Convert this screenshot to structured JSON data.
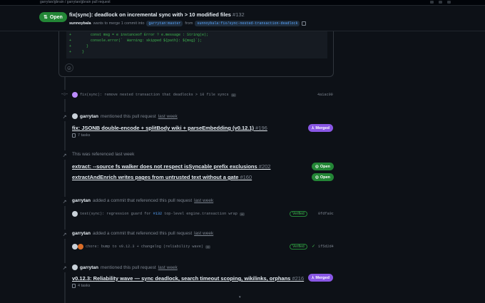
{
  "window": {
    "title": "garrytan/gbrain / garrytan/gbrain pull request"
  },
  "header": {
    "status": "Open",
    "title": "fix(sync): deadlock on incremental sync with > 10 modified files",
    "number": "#132",
    "author": "sunnoybala",
    "merge_text": "wants to merge 1 commit into",
    "base_branch": "garrytan:master",
    "from_text": "from",
    "head_branch": "sunnoybala:fix/sync-nested-transaction-deadlock"
  },
  "code": {
    "lines": [
      {
        "sign": "+",
        "text": "    const msg = e instanceof Error ? e.message : String(e);"
      },
      {
        "sign": "+",
        "text": "    console.error(`  Warning: skipped ${path}: ${msg}`);"
      },
      {
        "sign": "+",
        "text": "  }"
      },
      {
        "sign": "+",
        "text": "}"
      }
    ]
  },
  "timeline": {
    "commit1": {
      "message": "fix(sync): remove nested transaction that deadlocks > 10 file syncs",
      "sha": "4a1ac00"
    },
    "mention1": {
      "user": "garrytan",
      "action": "mentioned this pull request",
      "when": "last week",
      "title": "fix: JSONB double-encode + splitBody wiki + parseEmbedding (v0.12.1)",
      "number": "#196",
      "tasks": "7 tasks",
      "state": "Merged"
    },
    "referenced": {
      "text": "This was referenced last week",
      "items": [
        {
          "title": "extract: --source fs walker does not respect isSyncable prefix exclusions",
          "number": "#202",
          "state": "Open"
        },
        {
          "title": "extractAndEnrich writes pages from untrusted text without a gate",
          "number": "#160",
          "state": "Open"
        }
      ]
    },
    "commit_ref1": {
      "user": "garrytan",
      "action": "added a commit that referenced this pull request",
      "when": "last week",
      "message_a": "test(sync): regression guard for",
      "link": "#132",
      "message_b": "top-level engine.transaction wrap",
      "verified": "Verified",
      "sha": "0fdfa0c"
    },
    "commit_ref2": {
      "user": "garrytan",
      "action": "added a commit that referenced this pull request",
      "when": "last week",
      "message": "chore: bump to v0.12.3 + changelog (reliability wave)",
      "verified": "Verified",
      "sha": "1f5d2d4"
    },
    "mention2": {
      "user": "garrytan",
      "action": "mentioned this pull request",
      "when": "last week",
      "title": "v0.12.3: Reliability wave — sync deadlock, search timeout scoping, wikilinks, orphans",
      "number": "#216",
      "tasks": "4 tasks",
      "state": "Merged"
    }
  }
}
